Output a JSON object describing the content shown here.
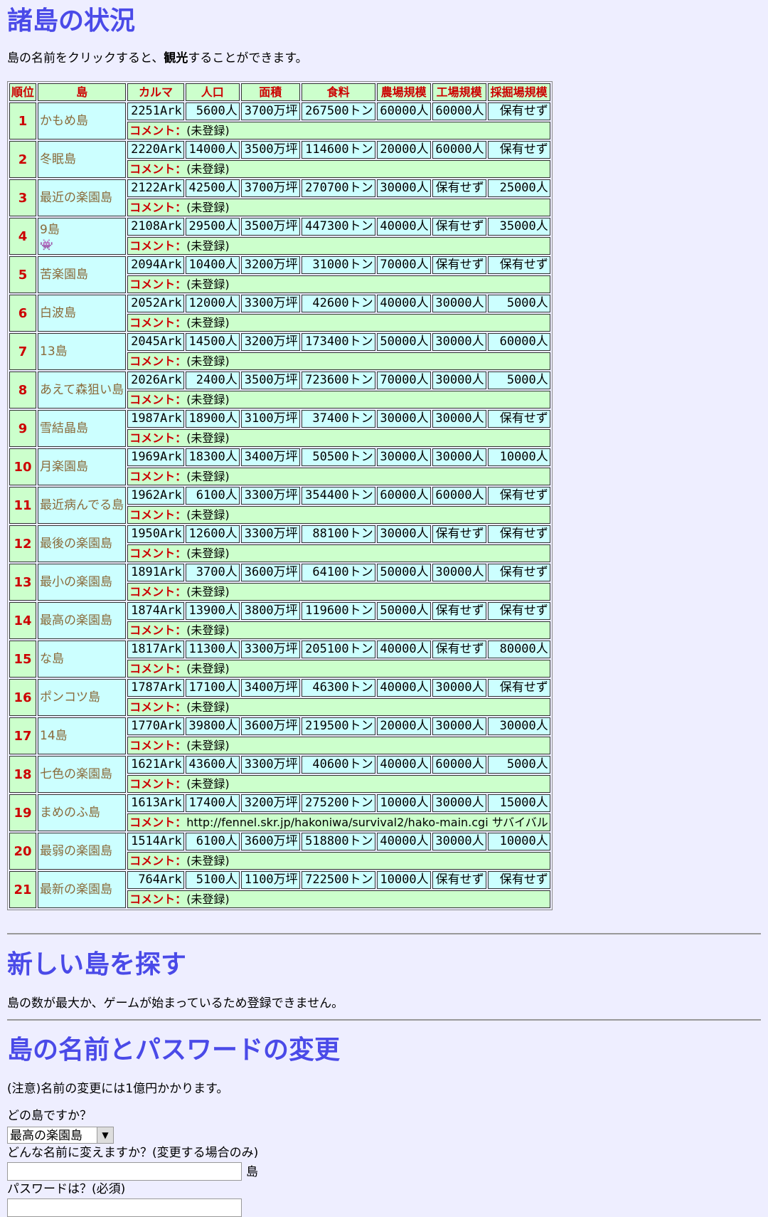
{
  "headings": {
    "status": "諸島の状況",
    "new_island": "新しい島を探す",
    "change": "島の名前とパスワードの変更"
  },
  "intro": {
    "before": "島の名前をクリックすると、",
    "bold": "観光",
    "after": "することができます。"
  },
  "table": {
    "headers": [
      "順位",
      "島",
      "カルマ",
      "人口",
      "面積",
      "食料",
      "農場規模",
      "工場規模",
      "採掘場規模"
    ],
    "comment_label": "コメント：",
    "rows": [
      {
        "rank": "1",
        "name": "かもめ島",
        "karma": "2251Ark",
        "pop": "5600人",
        "area": "3700万坪",
        "food": "267500トン",
        "farm": "60000人",
        "factory": "60000人",
        "mine": "保有せず",
        "comment": "(未登録)"
      },
      {
        "rank": "2",
        "name": "冬眠島",
        "karma": "2220Ark",
        "pop": "14000人",
        "area": "3500万坪",
        "food": "114600トン",
        "farm": "20000人",
        "factory": "60000人",
        "mine": "保有せず",
        "comment": "(未登録)"
      },
      {
        "rank": "3",
        "name": "最近の楽園島",
        "karma": "2122Ark",
        "pop": "42500人",
        "area": "3700万坪",
        "food": "270700トン",
        "farm": "30000人",
        "factory": "保有せず",
        "mine": "25000人",
        "comment": "(未登録)"
      },
      {
        "rank": "4",
        "name": "9島",
        "karma": "2108Ark",
        "pop": "29500人",
        "area": "3500万坪",
        "food": "447300トン",
        "farm": "40000人",
        "factory": "保有せず",
        "mine": "35000人",
        "comment": "(未登録)",
        "icon": "ghost-icon"
      },
      {
        "rank": "5",
        "name": "苦楽園島",
        "karma": "2094Ark",
        "pop": "10400人",
        "area": "3200万坪",
        "food": "31000トン",
        "farm": "70000人",
        "factory": "保有せず",
        "mine": "保有せず",
        "comment": "(未登録)"
      },
      {
        "rank": "6",
        "name": "白波島",
        "karma": "2052Ark",
        "pop": "12000人",
        "area": "3300万坪",
        "food": "42600トン",
        "farm": "40000人",
        "factory": "30000人",
        "mine": "5000人",
        "comment": "(未登録)"
      },
      {
        "rank": "7",
        "name": "13島",
        "karma": "2045Ark",
        "pop": "14500人",
        "area": "3200万坪",
        "food": "173400トン",
        "farm": "50000人",
        "factory": "30000人",
        "mine": "60000人",
        "comment": "(未登録)"
      },
      {
        "rank": "8",
        "name": "あえて森狙い島",
        "karma": "2026Ark",
        "pop": "2400人",
        "area": "3500万坪",
        "food": "723600トン",
        "farm": "70000人",
        "factory": "30000人",
        "mine": "5000人",
        "comment": "(未登録)"
      },
      {
        "rank": "9",
        "name": "雪結晶島",
        "karma": "1987Ark",
        "pop": "18900人",
        "area": "3100万坪",
        "food": "37400トン",
        "farm": "30000人",
        "factory": "30000人",
        "mine": "保有せず",
        "comment": "(未登録)"
      },
      {
        "rank": "10",
        "name": "月楽園島",
        "karma": "1969Ark",
        "pop": "18300人",
        "area": "3400万坪",
        "food": "50500トン",
        "farm": "30000人",
        "factory": "30000人",
        "mine": "10000人",
        "comment": "(未登録)"
      },
      {
        "rank": "11",
        "name": "最近病んでる島",
        "karma": "1962Ark",
        "pop": "6100人",
        "area": "3300万坪",
        "food": "354400トン",
        "farm": "60000人",
        "factory": "60000人",
        "mine": "保有せず",
        "comment": "(未登録)"
      },
      {
        "rank": "12",
        "name": "最後の楽園島",
        "karma": "1950Ark",
        "pop": "12600人",
        "area": "3300万坪",
        "food": "88100トン",
        "farm": "30000人",
        "factory": "保有せず",
        "mine": "保有せず",
        "comment": "(未登録)"
      },
      {
        "rank": "13",
        "name": "最小の楽園島",
        "karma": "1891Ark",
        "pop": "3700人",
        "area": "3600万坪",
        "food": "64100トン",
        "farm": "50000人",
        "factory": "30000人",
        "mine": "保有せず",
        "comment": "(未登録)"
      },
      {
        "rank": "14",
        "name": "最高の楽園島",
        "karma": "1874Ark",
        "pop": "13900人",
        "area": "3800万坪",
        "food": "119600トン",
        "farm": "50000人",
        "factory": "保有せず",
        "mine": "保有せず",
        "comment": "(未登録)"
      },
      {
        "rank": "15",
        "name": "な島",
        "karma": "1817Ark",
        "pop": "11300人",
        "area": "3300万坪",
        "food": "205100トン",
        "farm": "40000人",
        "factory": "保有せず",
        "mine": "80000人",
        "comment": "(未登録)"
      },
      {
        "rank": "16",
        "name": "ポンコツ島",
        "karma": "1787Ark",
        "pop": "17100人",
        "area": "3400万坪",
        "food": "46300トン",
        "farm": "40000人",
        "factory": "30000人",
        "mine": "保有せず",
        "comment": "(未登録)"
      },
      {
        "rank": "17",
        "name": "14島",
        "karma": "1770Ark",
        "pop": "39800人",
        "area": "3600万坪",
        "food": "219500トン",
        "farm": "20000人",
        "factory": "30000人",
        "mine": "30000人",
        "comment": "(未登録)"
      },
      {
        "rank": "18",
        "name": "七色の楽園島",
        "karma": "1621Ark",
        "pop": "43600人",
        "area": "3300万坪",
        "food": "40600トン",
        "farm": "40000人",
        "factory": "60000人",
        "mine": "5000人",
        "comment": "(未登録)"
      },
      {
        "rank": "19",
        "name": "まめのふ島",
        "karma": "1613Ark",
        "pop": "17400人",
        "area": "3200万坪",
        "food": "275200トン",
        "farm": "10000人",
        "factory": "30000人",
        "mine": "15000人",
        "comment": "http://fennel.skr.jp/hakoniwa/survival2/hako-main.cgi サバイバル"
      },
      {
        "rank": "20",
        "name": "最弱の楽園島",
        "karma": "1514Ark",
        "pop": "6100人",
        "area": "3600万坪",
        "food": "518800トン",
        "farm": "40000人",
        "factory": "30000人",
        "mine": "10000人",
        "comment": "(未登録)"
      },
      {
        "rank": "21",
        "name": "最新の楽園島",
        "karma": "764Ark",
        "pop": "5100人",
        "area": "1100万坪",
        "food": "722500トン",
        "farm": "10000人",
        "factory": "保有せず",
        "mine": "保有せず",
        "comment": "(未登録)"
      }
    ]
  },
  "new_island": {
    "message": "島の数が最大か、ゲームが始まっているため登録できません。"
  },
  "change_form": {
    "note": "(注意)名前の変更には1億円かかります。",
    "which_label": "どの島ですか？",
    "selected_island": "最高の楽園島",
    "name_label": "どんな名前に変えますか？(変更する場合のみ)",
    "name_value": "",
    "island_suffix": "島",
    "password_label": "パスワードは？(必須)",
    "password_value": ""
  }
}
